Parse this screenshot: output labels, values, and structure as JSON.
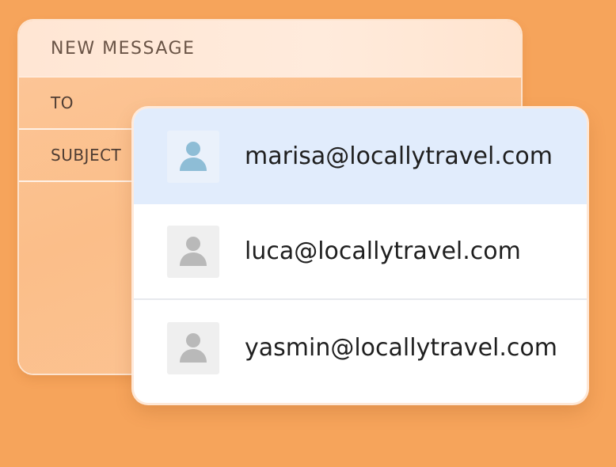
{
  "compose": {
    "title": "NEW MESSAGE",
    "to_label": "TO",
    "subject_label": "SUBJECT"
  },
  "suggestions": [
    {
      "email": "marisa@locallytravel.com",
      "icon": "person-icon",
      "selected": true
    },
    {
      "email": "luca@locallytravel.com",
      "icon": "person-icon",
      "selected": false
    },
    {
      "email": "yasmin@locallytravel.com",
      "icon": "person-icon",
      "selected": false
    }
  ],
  "colors": {
    "background": "#F6A45B",
    "selected_row": "#E1ECFC",
    "selected_avatar": "#8EBDD6",
    "default_avatar": "#B9B9B9"
  }
}
